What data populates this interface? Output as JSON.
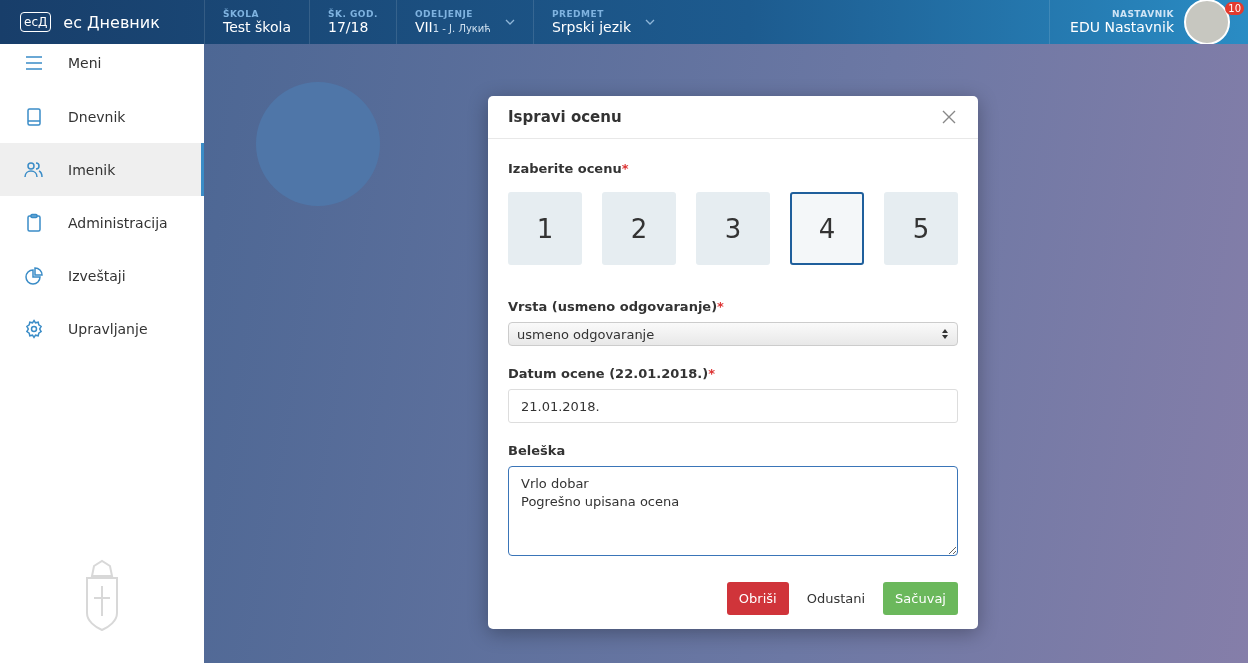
{
  "header": {
    "logo": "ecД",
    "brand": "ec Дневник",
    "fields": [
      {
        "label": "ŠKOLA",
        "value": "Test škola",
        "dropdown": false
      },
      {
        "label": "ŠK. GOD.",
        "value": "17/18",
        "dropdown": false
      },
      {
        "label": "ODELJENJE",
        "value": "VII",
        "detail": "1 - J. Лукић",
        "dropdown": true
      },
      {
        "label": "PREDMET",
        "value": "Srpski jezik",
        "dropdown": true
      }
    ],
    "user": {
      "role": "NASTAVNIK",
      "name": "EDU Nastavnik",
      "badge": "10"
    }
  },
  "sidebar": {
    "items": [
      {
        "label": "Meni",
        "selected": false
      },
      {
        "label": "Dnevnik",
        "selected": false
      },
      {
        "label": "Imenik",
        "selected": true
      },
      {
        "label": "Administracija",
        "selected": false
      },
      {
        "label": "Izveštaji",
        "selected": false
      },
      {
        "label": "Upravljanje",
        "selected": false
      }
    ]
  },
  "dialog": {
    "title": "Ispravi ocenu",
    "grade_label": {
      "text": "Izaberite ocenu",
      "required_mark": "*"
    },
    "grades": [
      {
        "label": "1",
        "selected": false
      },
      {
        "label": "2",
        "selected": false
      },
      {
        "label": "3",
        "selected": false
      },
      {
        "label": "4",
        "selected": true
      },
      {
        "label": "5",
        "selected": false
      }
    ],
    "type_label": {
      "text": "Vrsta (usmeno odgovaranje)",
      "required_mark": "*"
    },
    "type_value": "usmeno odgovaranje",
    "date_label": {
      "text": "Datum ocene (22.01.2018.)",
      "required_mark": "*"
    },
    "date_value": "21.01.2018.",
    "note_label": {
      "text": "Beleška"
    },
    "note_value": "Vrlo dobar\nPogrešno upisana ocena",
    "buttons": [
      {
        "label": "Obriši",
        "kind": "danger"
      },
      {
        "label": "Odustani",
        "kind": "plain"
      },
      {
        "label": "Sačuvaj",
        "kind": "success"
      }
    ]
  }
}
